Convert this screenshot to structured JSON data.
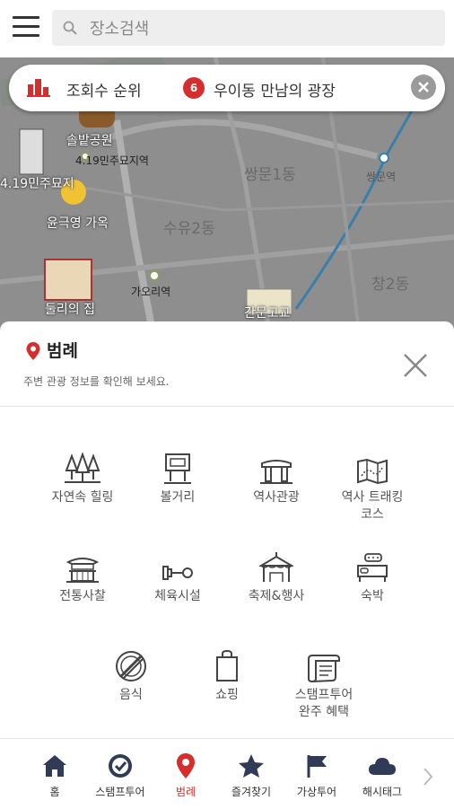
{
  "search": {
    "placeholder": "장소검색"
  },
  "ranking": {
    "label": "조회수 순위",
    "number": "6",
    "place": "우이동 만남의 광장"
  },
  "map": {
    "labels": [
      "쌍문1동",
      "수유2동",
      "창2동",
      "쌍문역",
      "가오리역",
      "4.19민주묘지역",
      "솔밭공원",
      "4.19민주묘지",
      "윤극영 가옥",
      "둘리의 집",
      "간문고교"
    ]
  },
  "panel": {
    "title": "범례",
    "subtitle": "주변 관광 정보를 확인해 보세요.",
    "categories": [
      {
        "label": "자연속 힐링",
        "icon": "forest-icon"
      },
      {
        "label": "볼거리",
        "icon": "signboard-icon"
      },
      {
        "label": "역사관광",
        "icon": "dolmen-icon"
      },
      {
        "label": "역사 트래킹\n코스",
        "icon": "trail-map-icon"
      },
      {
        "label": "전통사찰",
        "icon": "temple-icon"
      },
      {
        "label": "체육시설",
        "icon": "sports-icon"
      },
      {
        "label": "축제&행사",
        "icon": "festival-tent-icon"
      },
      {
        "label": "숙박",
        "icon": "bed-icon"
      },
      {
        "label": "음식",
        "icon": "food-icon"
      },
      {
        "label": "쇼핑",
        "icon": "shopping-bag-icon"
      },
      {
        "label": "스탬프투어\n완주 혜택",
        "icon": "certificate-icon"
      }
    ]
  },
  "nav": {
    "items": [
      {
        "label": "홈",
        "icon": "home-icon"
      },
      {
        "label": "스탬프투어",
        "icon": "stamp-badge-icon"
      },
      {
        "label": "범례",
        "icon": "location-pin-icon"
      },
      {
        "label": "즐겨찾기",
        "icon": "star-icon"
      },
      {
        "label": "가상투어",
        "icon": "flag-icon"
      },
      {
        "label": "해시태그",
        "icon": "cloud-icon"
      }
    ]
  },
  "colors": {
    "accent": "#d62d2d",
    "nav_icon": "#2f3b57",
    "map_bg": "#8c8c8c"
  }
}
